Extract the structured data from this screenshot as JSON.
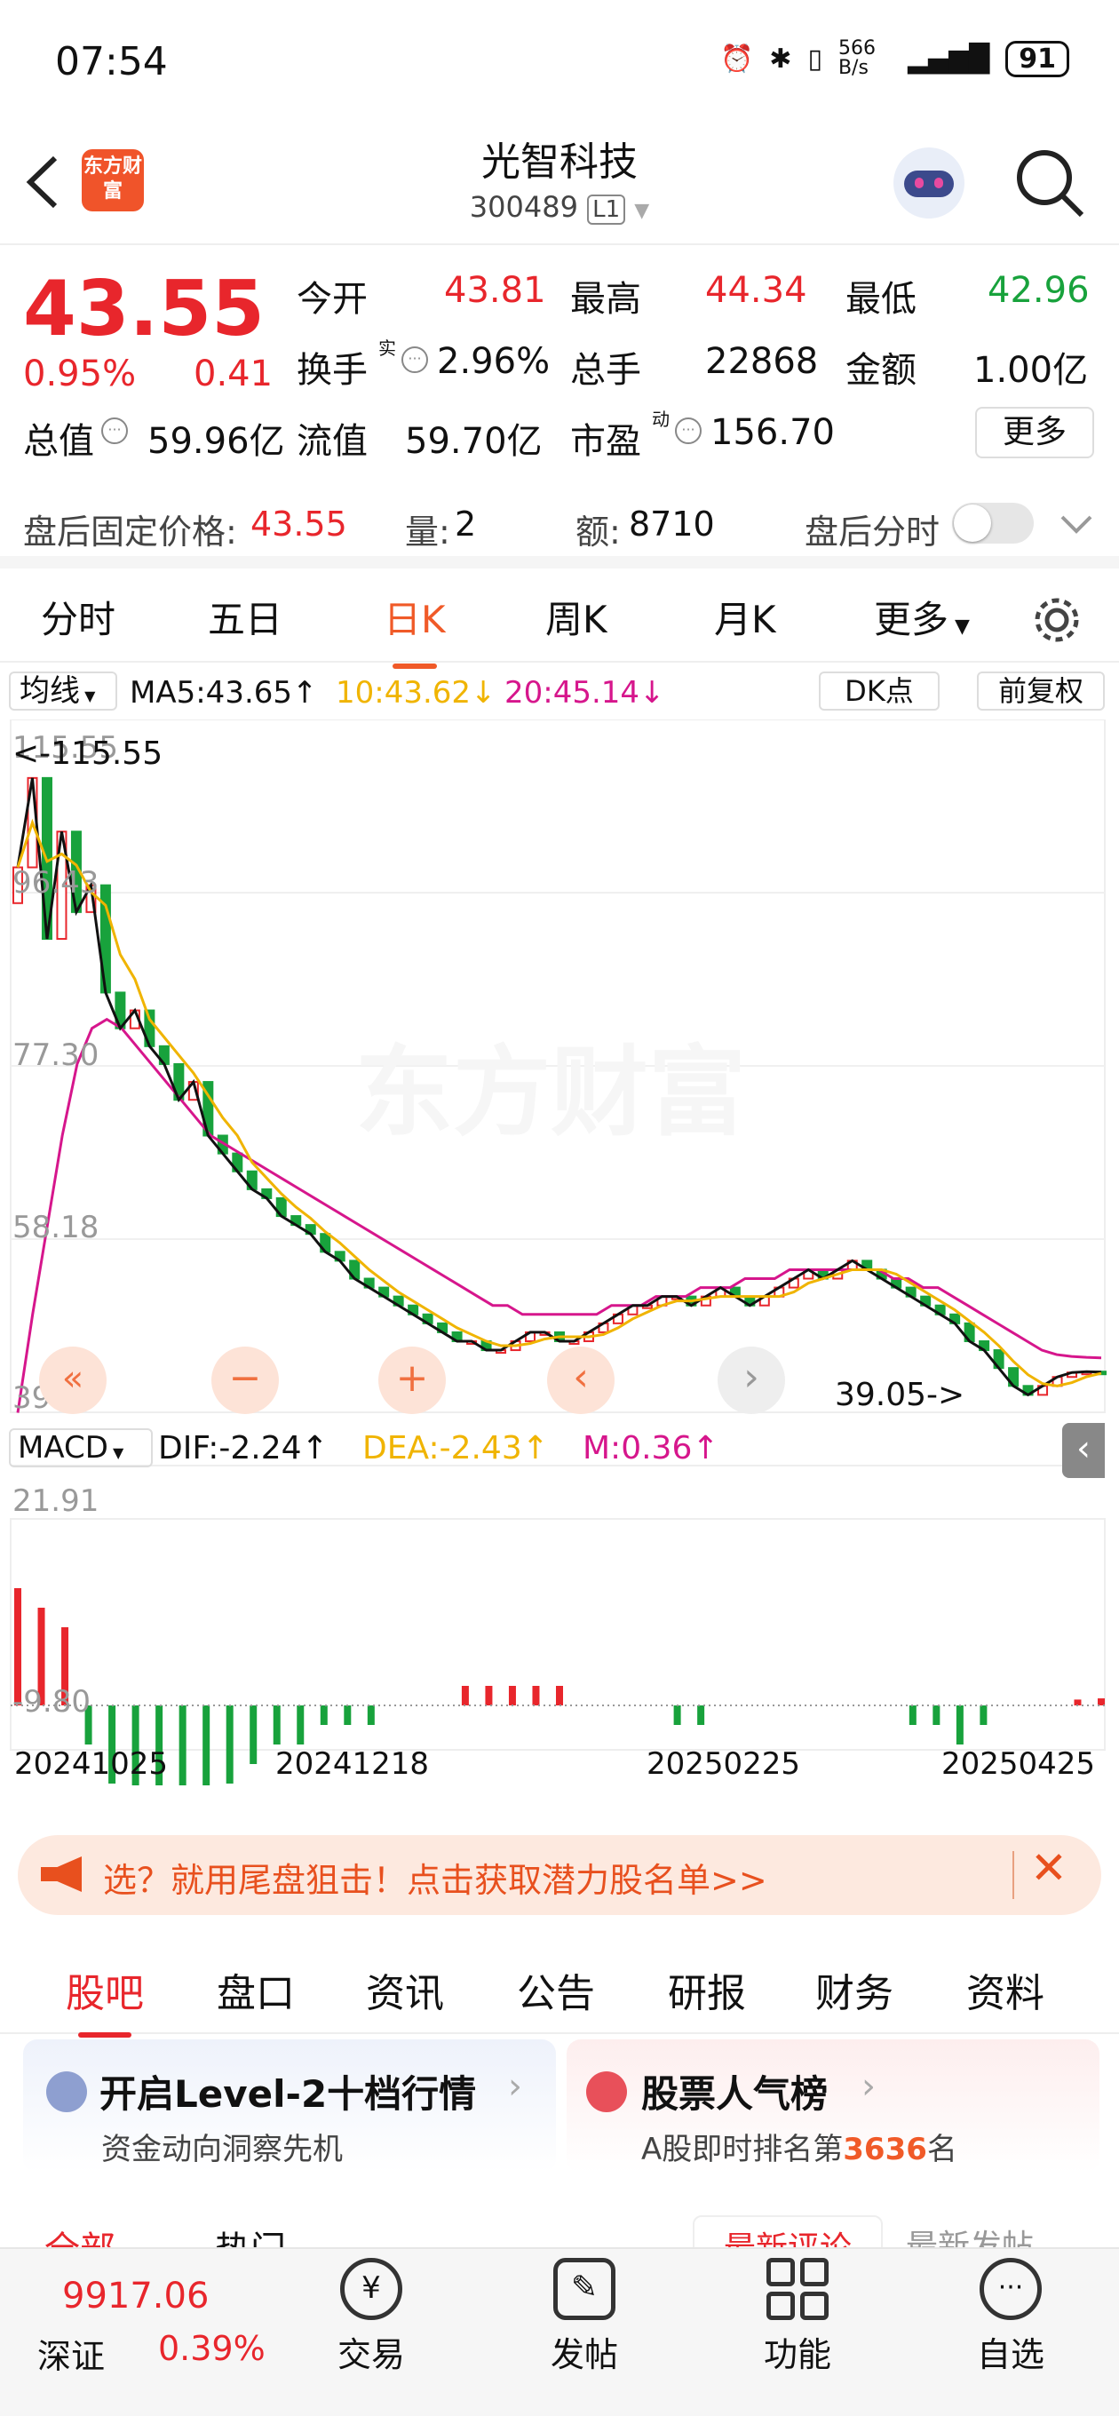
{
  "status_bar": {
    "time": "07:54",
    "net_speed": "566 B/s",
    "battery": "91"
  },
  "header": {
    "logo_text": "东方财富",
    "title": "光智科技",
    "code": "300489",
    "level": "L1"
  },
  "quote": {
    "price": "43.55",
    "change_pct": "0.95%",
    "change_amt": "0.41",
    "fields": [
      {
        "label": "今开",
        "value": "43.81",
        "color": "#e8262c"
      },
      {
        "label": "最高",
        "value": "44.34",
        "color": "#e8262c"
      },
      {
        "label": "最低",
        "value": "42.96",
        "color": "#18a23c"
      },
      {
        "label": "换手",
        "value": "2.96%",
        "color": "#111111"
      },
      {
        "label": "总手",
        "value": "22868",
        "color": "#111111"
      },
      {
        "label": "金额",
        "value": "1.00亿",
        "color": "#111111"
      },
      {
        "label": "总值",
        "value": "59.96亿",
        "color": "#111111"
      },
      {
        "label": "流值",
        "value": "59.70亿",
        "color": "#111111"
      },
      {
        "label": "市盈",
        "value": "156.70",
        "color": "#111111"
      }
    ],
    "sup_shi": "实",
    "sup_dong": "动",
    "more_button": "更多"
  },
  "after_hours": {
    "label": "盘后固定价格:",
    "price": "43.55",
    "vol_label": "量:",
    "vol": "2",
    "amt_label": "额:",
    "amt": "8710",
    "timeshare_label": "盘后分时"
  },
  "k_tabs": {
    "items": [
      "分时",
      "五日",
      "日K",
      "周K",
      "月K",
      "更多"
    ],
    "active": 2
  },
  "chart_header": {
    "ma_toggle": "均线",
    "ma5": "MA5:43.65↑",
    "ma10": "10:43.62↓",
    "ma20": "20:45.14↓",
    "dk_button": "DK点",
    "fq_button": "前复权"
  },
  "chart_labels": {
    "y_top": "115.55",
    "y2": "96.43",
    "y3": "77.30",
    "y4": "58.18",
    "y_bottom": "39.05",
    "max_marker": "<-115.55",
    "min_marker": "39.05->",
    "watermark": "东方财富"
  },
  "macd_header": {
    "toggle": "MACD",
    "dif": "DIF:-2.24↑",
    "dea": "DEA:-2.43↑",
    "m": "M:0.36↑",
    "y_top": "21.91",
    "y_bottom": "-9.80"
  },
  "x_axis": {
    "labels": [
      "20241025",
      "20241218",
      "20250225",
      "20250425"
    ]
  },
  "chart_data": {
    "type": "candlestick",
    "y_range": [
      39.05,
      115.55
    ],
    "dates": [
      "20241025",
      "20241218",
      "20250225",
      "20250425"
    ],
    "close": [
      100,
      110,
      92,
      104,
      95,
      98,
      86,
      82,
      84,
      80,
      78,
      74,
      76,
      70,
      68,
      66,
      64,
      63,
      61,
      60,
      59,
      57,
      56,
      54,
      53,
      52,
      51,
      50,
      49,
      48,
      47,
      47,
      46,
      46,
      47,
      48,
      48,
      47,
      47,
      48,
      49,
      50,
      51,
      51,
      52,
      52,
      51,
      52,
      53,
      52,
      51,
      52,
      53,
      54,
      55,
      54,
      55,
      56,
      55,
      54,
      53,
      52,
      51,
      50,
      49,
      47,
      46,
      44,
      42,
      41,
      42,
      43,
      43.5,
      43.6,
      43.55
    ],
    "ma20": [
      39,
      50,
      60,
      70,
      78,
      82,
      83,
      82,
      80,
      78,
      76,
      74,
      72,
      70,
      69,
      68,
      67,
      66,
      65,
      64,
      63,
      62,
      61,
      60,
      59,
      58,
      57,
      56,
      55,
      54,
      53,
      52,
      51,
      51,
      50,
      50,
      50,
      50,
      50,
      50,
      51,
      51,
      51,
      52,
      52,
      52,
      53,
      53,
      53,
      54,
      54,
      54,
      55,
      55,
      55,
      55,
      55,
      55,
      55,
      54,
      54,
      53,
      53,
      52,
      51,
      50,
      49,
      48,
      47,
      46,
      45.5,
      45.3,
      45.2,
      45.14
    ],
    "macd_hist": [
      6,
      5,
      4,
      -2,
      -4,
      -5,
      -6,
      -6,
      -5,
      -4,
      -3,
      -2,
      -2,
      -1,
      -1,
      -1,
      0,
      0,
      0,
      1,
      1,
      1,
      1,
      1,
      0,
      0,
      0,
      0,
      -1,
      -1,
      0,
      0,
      0,
      0,
      0,
      0,
      0,
      0,
      -1,
      -1,
      -2,
      -1,
      0,
      0,
      0,
      0.3,
      0.36
    ]
  },
  "banner": {
    "text": "选？就用尾盘狙击！点击获取潜力股名单>>"
  },
  "section_tabs": {
    "items": [
      "股吧",
      "盘口",
      "资讯",
      "公告",
      "研报",
      "财务",
      "资料"
    ],
    "active": 0
  },
  "cards": [
    {
      "title": "开启Level-2十档行情",
      "subtitle": "资金动向洞察先机"
    },
    {
      "title": "股票人气榜",
      "subtitle_pre": "A股即时排名第",
      "rank": "3636",
      "subtitle_post": "名"
    }
  ],
  "partial_tabs": [
    "全部",
    "热门",
    "最新评论",
    "最新发帖"
  ],
  "bottom_bar": {
    "index_value": "9917.06",
    "index_name": "深证",
    "index_change": "0.39%",
    "items": [
      "交易",
      "发帖",
      "功能",
      "自选"
    ]
  }
}
